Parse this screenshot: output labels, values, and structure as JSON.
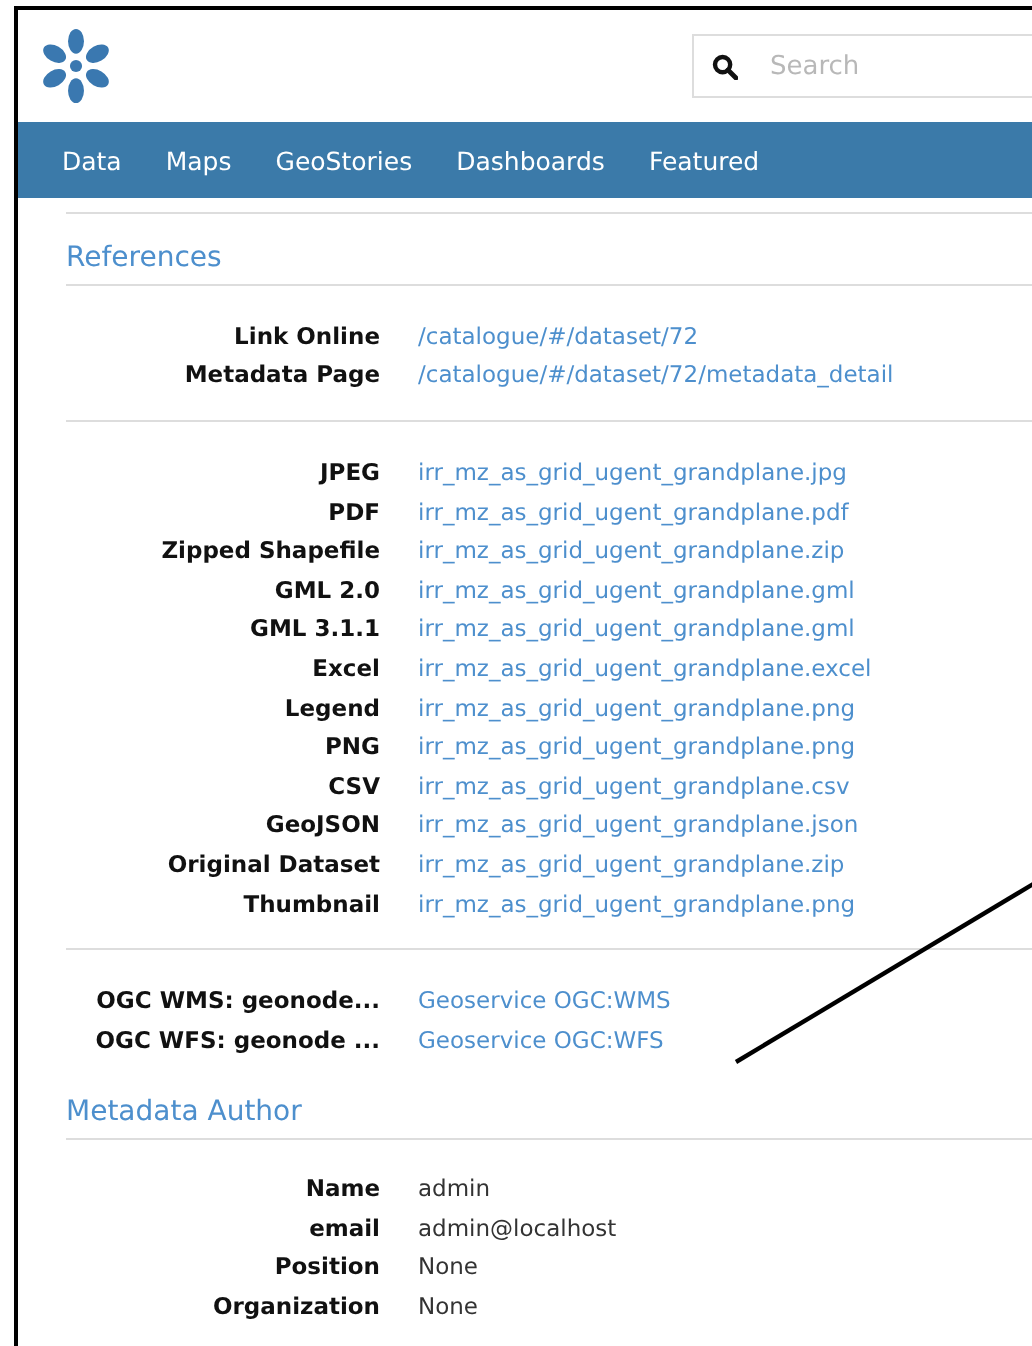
{
  "header": {
    "search": {
      "placeholder": "Search"
    }
  },
  "nav": {
    "items": [
      {
        "label": "Data"
      },
      {
        "label": "Maps"
      },
      {
        "label": "GeoStories"
      },
      {
        "label": "Dashboards"
      },
      {
        "label": "Featured"
      }
    ]
  },
  "sections": [
    {
      "title": "References",
      "kind": "link",
      "groups": [
        [
          {
            "label": "Link Online",
            "value": "/catalogue/#/dataset/72"
          },
          {
            "label": "Metadata Page",
            "value": "/catalogue/#/dataset/72/metadata_detail"
          }
        ],
        [
          {
            "label": "JPEG",
            "value": "irr_mz_as_grid_ugent_grandplane.jpg"
          },
          {
            "label": "PDF",
            "value": "irr_mz_as_grid_ugent_grandplane.pdf"
          },
          {
            "label": "Zipped Shapefile",
            "value": "irr_mz_as_grid_ugent_grandplane.zip"
          },
          {
            "label": "GML 2.0",
            "value": "irr_mz_as_grid_ugent_grandplane.gml"
          },
          {
            "label": "GML 3.1.1",
            "value": "irr_mz_as_grid_ugent_grandplane.gml"
          },
          {
            "label": "Excel",
            "value": "irr_mz_as_grid_ugent_grandplane.excel"
          },
          {
            "label": "Legend",
            "value": "irr_mz_as_grid_ugent_grandplane.png"
          },
          {
            "label": "PNG",
            "value": "irr_mz_as_grid_ugent_grandplane.png"
          },
          {
            "label": "CSV",
            "value": "irr_mz_as_grid_ugent_grandplane.csv"
          },
          {
            "label": "GeoJSON",
            "value": "irr_mz_as_grid_ugent_grandplane.json"
          },
          {
            "label": "Original Dataset",
            "value": "irr_mz_as_grid_ugent_grandplane.zip"
          },
          {
            "label": "Thumbnail",
            "value": "irr_mz_as_grid_ugent_grandplane.png"
          }
        ],
        [
          {
            "label": "OGC WMS: geonode...",
            "value": "Geoservice OGC:WMS"
          },
          {
            "label": "OGC WFS: geonode ...",
            "value": "Geoservice OGC:WFS"
          }
        ]
      ]
    },
    {
      "title": "Metadata Author",
      "kind": "text",
      "groups": [
        [
          {
            "label": "Name",
            "value": "admin"
          },
          {
            "label": "email",
            "value": "admin@localhost"
          },
          {
            "label": "Position",
            "value": "None"
          },
          {
            "label": "Organization",
            "value": "None"
          }
        ]
      ]
    }
  ]
}
